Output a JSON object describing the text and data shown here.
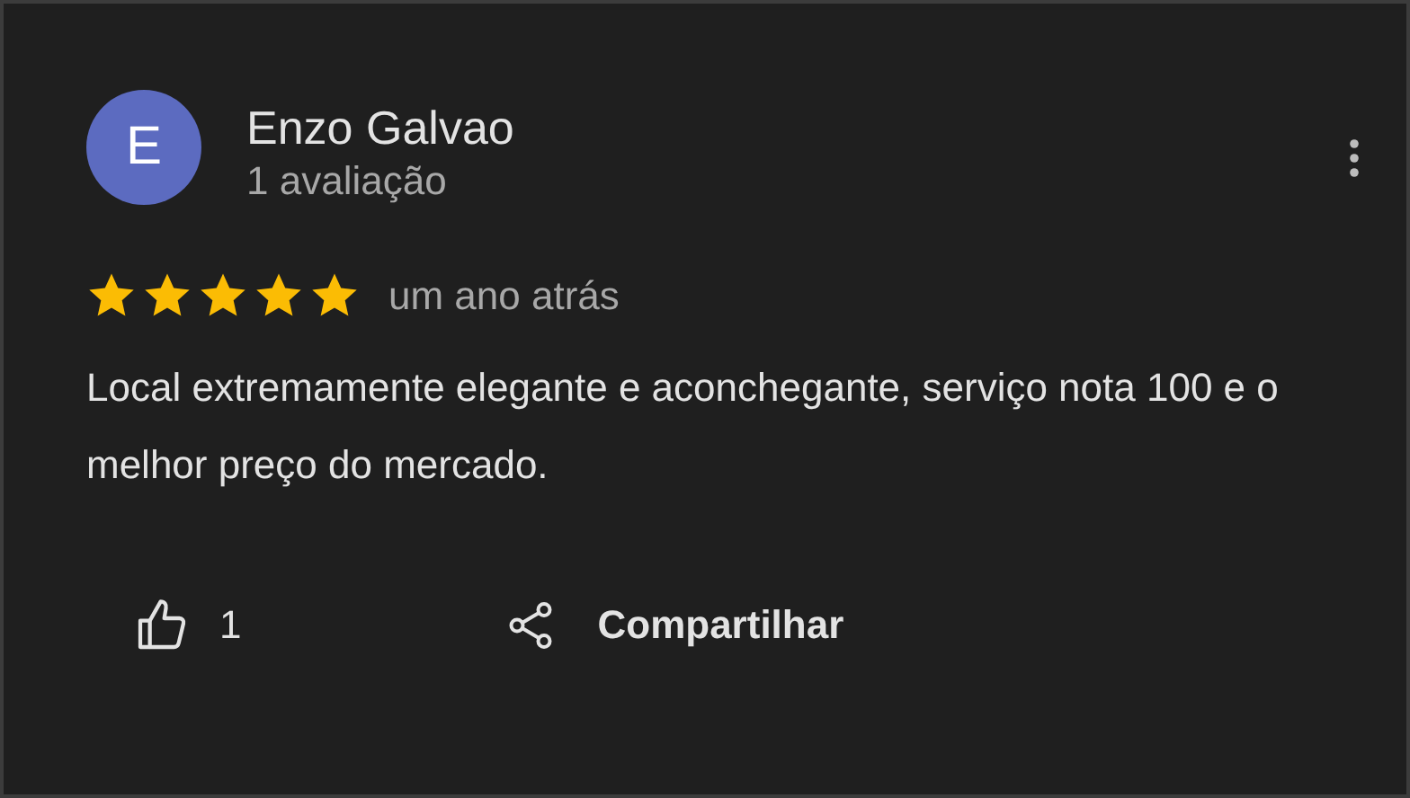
{
  "review": {
    "avatar_letter": "E",
    "author": "Enzo Galvao",
    "author_meta": "1 avaliação",
    "stars": 5,
    "time": "um ano atrás",
    "text": "Local extremamente elegante e aconchegante, serviço nota 100 e o melhor preço do mercado.",
    "like_count": "1",
    "share_label": "Compartilhar"
  }
}
